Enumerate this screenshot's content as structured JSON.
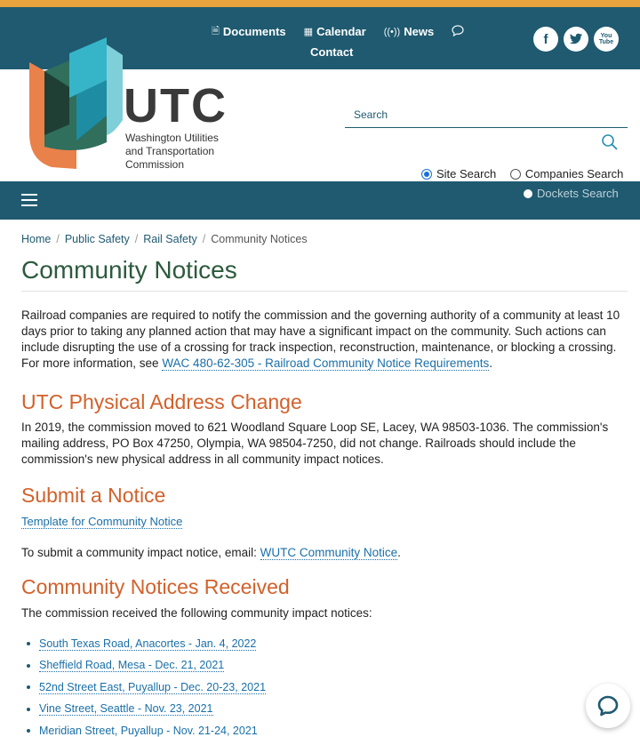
{
  "topnav": {
    "documents": "Documents",
    "calendar": "Calendar",
    "news": "News",
    "contact": "Contact"
  },
  "social": {
    "facebook": "f",
    "twitter": "t",
    "youtube_top": "You",
    "youtube_bottom": "Tube"
  },
  "brand": {
    "name": "UTC",
    "line1": "Washington Utilities",
    "line2": "and Transportation",
    "line3": "Commission"
  },
  "search": {
    "label": "Search",
    "options": [
      "Site Search",
      "Companies Search",
      "Dockets Search"
    ],
    "selected": "Site Search"
  },
  "breadcrumb": {
    "home": "Home",
    "public_safety": "Public Safety",
    "rail_safety": "Rail Safety",
    "current": "Community Notices",
    "separator": "/"
  },
  "page": {
    "title": "Community Notices",
    "intro_text": "Railroad companies are required to notify the commission and the governing authority of a community at least 10 days prior to taking any planned action that may have a significant impact on the community. Such actions can include disrupting the use of a crossing for track inspection, reconstruction, maintenance, or blocking a crossing. For more information, see ",
    "intro_link": "WAC 480-62-305 - Railroad Community Notice Requirements",
    "intro_end": ".",
    "address_heading": "UTC Physical Address Change",
    "address_text": "In 2019, the commission moved to 621 Woodland Square Loop SE, Lacey, WA 98503-1036. The commission's mailing address, PO Box 47250, Olympia, WA 98504-7250, did not change. Railroads should include the commission's new physical address in all community impact notices.",
    "submit_heading": "Submit a Notice",
    "template_link": "Template for Community Notice",
    "submit_text": "To submit a community impact notice, email: ",
    "submit_link": "WUTC Community Notice",
    "submit_end": ".",
    "received_heading": "Community Notices Received",
    "received_text": "The commission received the following community impact notices:",
    "notices": [
      "South Texas Road, Anacortes - Jan. 4, 2022",
      "Sheffield Road, Mesa - Dec. 21, 2021",
      "52nd Street East, Puyallup - Dec. 20-23, 2021",
      "Vine Street, Seattle - Nov. 23, 2021",
      "Meridian Street, Puyallup - Nov. 21-24, 2021"
    ]
  },
  "colors": {
    "header": "#1f5a70",
    "accent": "#e9a33c",
    "title_green": "#2d5a3d",
    "heading_orange": "#d2612b",
    "link": "#1a6fa8"
  }
}
